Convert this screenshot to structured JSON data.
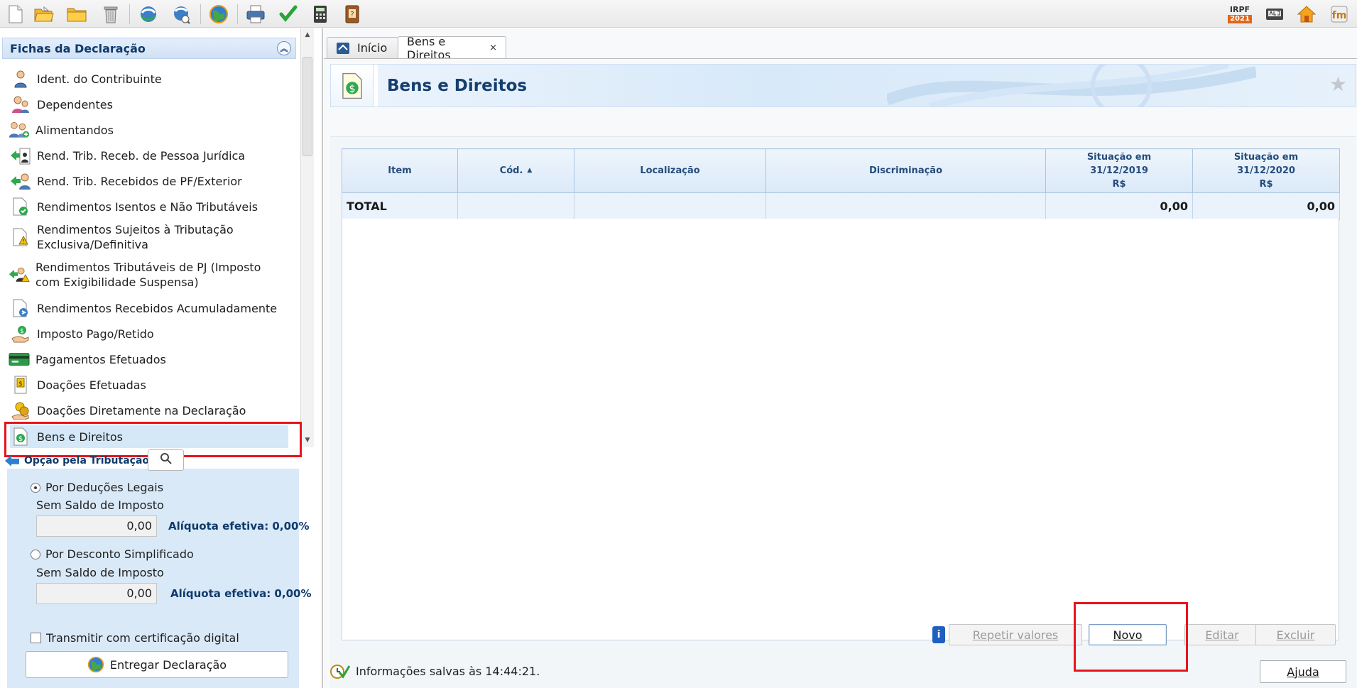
{
  "toolbar": {
    "left_icons": [
      "new-document-icon",
      "open-folder-icon",
      "folder-icon",
      "trash-icon",
      "transmit-icon",
      "recover-icon",
      "globe-icon",
      "print-icon",
      "check-icon",
      "calculator-icon",
      "book-icon"
    ],
    "irpf_top": "IRPF",
    "irpf_year": "2021",
    "right_icons": [
      "irpf-2021-icon",
      "abc-icon",
      "home-icon",
      "fm-icon"
    ]
  },
  "sidebar": {
    "title": "Fichas da Declaração",
    "items": [
      {
        "label": "Ident. do Contribuinte",
        "icon": "person-icon"
      },
      {
        "label": "Dependentes",
        "icon": "dependents-icon"
      },
      {
        "label": "Alimentandos",
        "icon": "alimentandos-icon"
      },
      {
        "label": "Rend. Trib. Receb. de Pessoa Jurídica",
        "icon": "income-pj-icon"
      },
      {
        "label": "Rend. Trib. Recebidos de PF/Exterior",
        "icon": "income-pf-icon"
      },
      {
        "label": "Rendimentos Isentos e Não Tributáveis",
        "icon": "exempt-icon"
      },
      {
        "label": "Rendimentos Sujeitos à Tributação Exclusiva/Definitiva",
        "icon": "exclusive-icon"
      },
      {
        "label": "Rendimentos Tributáveis de PJ (Imposto com Exigibilidade Suspensa)",
        "icon": "suspended-icon"
      },
      {
        "label": "Rendimentos Recebidos Acumuladamente",
        "icon": "accumulated-icon"
      },
      {
        "label": "Imposto Pago/Retido",
        "icon": "tax-paid-icon"
      },
      {
        "label": "Pagamentos Efetuados",
        "icon": "payments-icon"
      },
      {
        "label": "Doações Efetuadas",
        "icon": "donations-icon"
      },
      {
        "label": "Doações Diretamente na Declaração",
        "icon": "direct-donations-icon"
      },
      {
        "label": "Bens e Direitos",
        "icon": "assets-icon"
      }
    ],
    "selected_index": 13
  },
  "tax": {
    "title": "Opção pela Tributação:",
    "legal": {
      "label": "Por Deduções Legais",
      "sub": "Sem Saldo de Imposto",
      "value": "0,00",
      "aliquota": "Alíquota efetiva: 0,00%",
      "selected": true
    },
    "simple": {
      "label": "Por Desconto Simplificado",
      "sub": "Sem Saldo de Imposto",
      "value": "0,00",
      "aliquota": "Alíquota efetiva: 0,00%",
      "selected": false
    },
    "transmit_label": "Transmitir com certificação digital",
    "deliver_label": "Entregar Declaração"
  },
  "tabs": [
    {
      "label": "Início",
      "active": false
    },
    {
      "label": "Bens e Direitos",
      "active": true,
      "close": "×"
    }
  ],
  "page": {
    "title": "Bens e Direitos"
  },
  "grid": {
    "headers": [
      "Item",
      "Cód.",
      "Localização",
      "Discriminação",
      "Situação em 31/12/2019 R$",
      "Situação em 31/12/2020 R$"
    ],
    "header_lines": {
      "col5": [
        "Situação em",
        "31/12/2019",
        "R$"
      ],
      "col6": [
        "Situação em",
        "31/12/2020",
        "R$"
      ]
    },
    "total_row": {
      "label": "TOTAL",
      "v2019": "0,00",
      "v2020": "0,00"
    }
  },
  "actions": {
    "repeat": "Repetir valores",
    "new": "Novo",
    "edit": "Editar",
    "delete": "Excluir",
    "help": "Ajuda"
  },
  "status": {
    "text": "Informações salvas às 14:44:21."
  },
  "colors": {
    "accent": "#153e6e",
    "selection": "#d5e8f8",
    "highlight_red": "#e8141c"
  }
}
